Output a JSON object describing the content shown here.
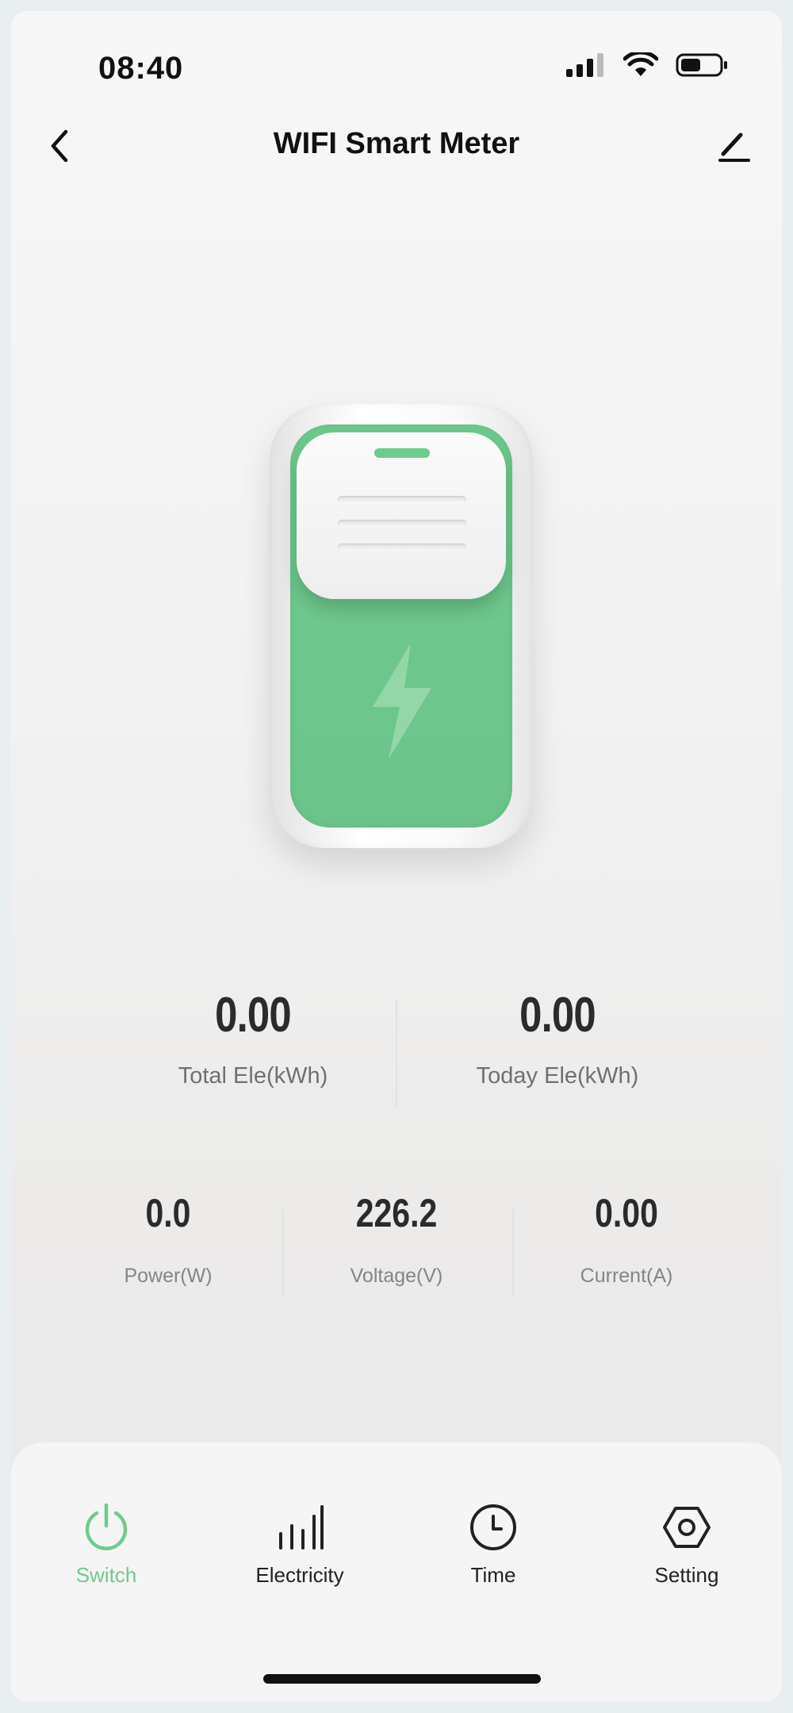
{
  "status_bar": {
    "time": "08:40"
  },
  "nav": {
    "title": "WIFI Smart Meter"
  },
  "stats": {
    "total_ele": {
      "value": "0.00",
      "label": "Total Ele(kWh)"
    },
    "today_ele": {
      "value": "0.00",
      "label": "Today Ele(kWh)"
    },
    "power": {
      "value": "0.0",
      "label": "Power(W)"
    },
    "voltage": {
      "value": "226.2",
      "label": "Voltage(V)"
    },
    "current": {
      "value": "0.00",
      "label": "Current(A)"
    }
  },
  "tabs": [
    {
      "label": "Switch",
      "icon": "power-icon",
      "active": true
    },
    {
      "label": "Electricity",
      "icon": "bar-chart-icon",
      "active": false
    },
    {
      "label": "Time",
      "icon": "clock-icon",
      "active": false
    },
    {
      "label": "Setting",
      "icon": "hexagon-settings-icon",
      "active": false
    }
  ],
  "colors": {
    "accent": "#6fca8e",
    "text": "#2b2b2b",
    "muted": "#707070"
  }
}
